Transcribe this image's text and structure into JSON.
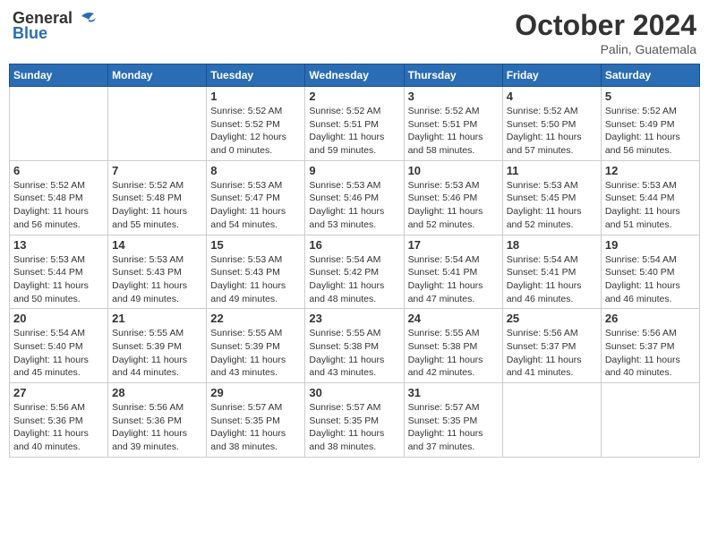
{
  "header": {
    "logo_general": "General",
    "logo_blue": "Blue",
    "month": "October 2024",
    "location": "Palin, Guatemala"
  },
  "days_of_week": [
    "Sunday",
    "Monday",
    "Tuesday",
    "Wednesday",
    "Thursday",
    "Friday",
    "Saturday"
  ],
  "weeks": [
    [
      {
        "day": "",
        "info": ""
      },
      {
        "day": "",
        "info": ""
      },
      {
        "day": "1",
        "info": "Sunrise: 5:52 AM\nSunset: 5:52 PM\nDaylight: 12 hours and 0 minutes."
      },
      {
        "day": "2",
        "info": "Sunrise: 5:52 AM\nSunset: 5:51 PM\nDaylight: 11 hours and 59 minutes."
      },
      {
        "day": "3",
        "info": "Sunrise: 5:52 AM\nSunset: 5:51 PM\nDaylight: 11 hours and 58 minutes."
      },
      {
        "day": "4",
        "info": "Sunrise: 5:52 AM\nSunset: 5:50 PM\nDaylight: 11 hours and 57 minutes."
      },
      {
        "day": "5",
        "info": "Sunrise: 5:52 AM\nSunset: 5:49 PM\nDaylight: 11 hours and 56 minutes."
      }
    ],
    [
      {
        "day": "6",
        "info": "Sunrise: 5:52 AM\nSunset: 5:48 PM\nDaylight: 11 hours and 56 minutes."
      },
      {
        "day": "7",
        "info": "Sunrise: 5:52 AM\nSunset: 5:48 PM\nDaylight: 11 hours and 55 minutes."
      },
      {
        "day": "8",
        "info": "Sunrise: 5:53 AM\nSunset: 5:47 PM\nDaylight: 11 hours and 54 minutes."
      },
      {
        "day": "9",
        "info": "Sunrise: 5:53 AM\nSunset: 5:46 PM\nDaylight: 11 hours and 53 minutes."
      },
      {
        "day": "10",
        "info": "Sunrise: 5:53 AM\nSunset: 5:46 PM\nDaylight: 11 hours and 52 minutes."
      },
      {
        "day": "11",
        "info": "Sunrise: 5:53 AM\nSunset: 5:45 PM\nDaylight: 11 hours and 52 minutes."
      },
      {
        "day": "12",
        "info": "Sunrise: 5:53 AM\nSunset: 5:44 PM\nDaylight: 11 hours and 51 minutes."
      }
    ],
    [
      {
        "day": "13",
        "info": "Sunrise: 5:53 AM\nSunset: 5:44 PM\nDaylight: 11 hours and 50 minutes."
      },
      {
        "day": "14",
        "info": "Sunrise: 5:53 AM\nSunset: 5:43 PM\nDaylight: 11 hours and 49 minutes."
      },
      {
        "day": "15",
        "info": "Sunrise: 5:53 AM\nSunset: 5:43 PM\nDaylight: 11 hours and 49 minutes."
      },
      {
        "day": "16",
        "info": "Sunrise: 5:54 AM\nSunset: 5:42 PM\nDaylight: 11 hours and 48 minutes."
      },
      {
        "day": "17",
        "info": "Sunrise: 5:54 AM\nSunset: 5:41 PM\nDaylight: 11 hours and 47 minutes."
      },
      {
        "day": "18",
        "info": "Sunrise: 5:54 AM\nSunset: 5:41 PM\nDaylight: 11 hours and 46 minutes."
      },
      {
        "day": "19",
        "info": "Sunrise: 5:54 AM\nSunset: 5:40 PM\nDaylight: 11 hours and 46 minutes."
      }
    ],
    [
      {
        "day": "20",
        "info": "Sunrise: 5:54 AM\nSunset: 5:40 PM\nDaylight: 11 hours and 45 minutes."
      },
      {
        "day": "21",
        "info": "Sunrise: 5:55 AM\nSunset: 5:39 PM\nDaylight: 11 hours and 44 minutes."
      },
      {
        "day": "22",
        "info": "Sunrise: 5:55 AM\nSunset: 5:39 PM\nDaylight: 11 hours and 43 minutes."
      },
      {
        "day": "23",
        "info": "Sunrise: 5:55 AM\nSunset: 5:38 PM\nDaylight: 11 hours and 43 minutes."
      },
      {
        "day": "24",
        "info": "Sunrise: 5:55 AM\nSunset: 5:38 PM\nDaylight: 11 hours and 42 minutes."
      },
      {
        "day": "25",
        "info": "Sunrise: 5:56 AM\nSunset: 5:37 PM\nDaylight: 11 hours and 41 minutes."
      },
      {
        "day": "26",
        "info": "Sunrise: 5:56 AM\nSunset: 5:37 PM\nDaylight: 11 hours and 40 minutes."
      }
    ],
    [
      {
        "day": "27",
        "info": "Sunrise: 5:56 AM\nSunset: 5:36 PM\nDaylight: 11 hours and 40 minutes."
      },
      {
        "day": "28",
        "info": "Sunrise: 5:56 AM\nSunset: 5:36 PM\nDaylight: 11 hours and 39 minutes."
      },
      {
        "day": "29",
        "info": "Sunrise: 5:57 AM\nSunset: 5:35 PM\nDaylight: 11 hours and 38 minutes."
      },
      {
        "day": "30",
        "info": "Sunrise: 5:57 AM\nSunset: 5:35 PM\nDaylight: 11 hours and 38 minutes."
      },
      {
        "day": "31",
        "info": "Sunrise: 5:57 AM\nSunset: 5:35 PM\nDaylight: 11 hours and 37 minutes."
      },
      {
        "day": "",
        "info": ""
      },
      {
        "day": "",
        "info": ""
      }
    ]
  ]
}
